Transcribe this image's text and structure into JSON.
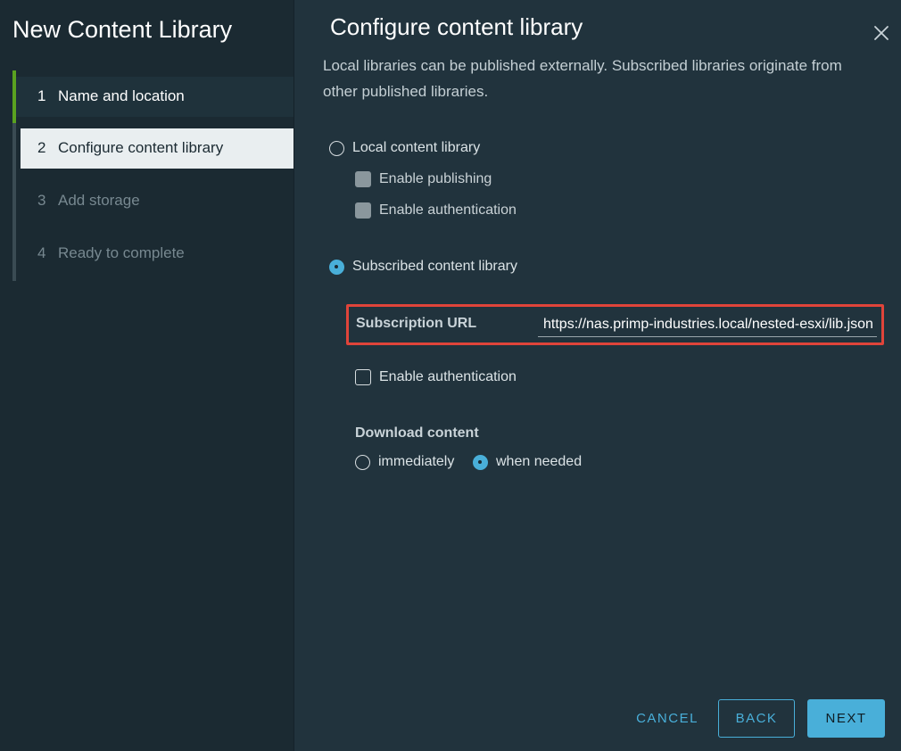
{
  "wizard": {
    "title": "New Content Library",
    "steps": [
      {
        "num": "1",
        "label": "Name and location"
      },
      {
        "num": "2",
        "label": "Configure content library"
      },
      {
        "num": "3",
        "label": "Add storage"
      },
      {
        "num": "4",
        "label": "Ready to complete"
      }
    ]
  },
  "main": {
    "title": "Configure content library",
    "description": "Local libraries can be published externally. Subscribed libraries originate from other published libraries.",
    "local_library": {
      "label": "Local content library",
      "selected": false,
      "enable_publishing": "Enable publishing",
      "enable_authentication": "Enable authentication"
    },
    "subscribed_library": {
      "label": "Subscribed content library",
      "selected": true,
      "subscription_url_label": "Subscription URL",
      "subscription_url_value": "https://nas.primp-industries.local/nested-esxi/lib.json",
      "enable_authentication": "Enable authentication",
      "download_content_label": "Download content",
      "download_options": [
        "immediately",
        "when needed"
      ],
      "download_selected": "when needed"
    }
  },
  "footer": {
    "cancel": "CANCEL",
    "back": "BACK",
    "next": "NEXT"
  },
  "colors": {
    "accent": "#49afd9",
    "done_step": "#5aa220",
    "highlight_box": "#e0443a"
  },
  "icons": {
    "close": "close-icon"
  }
}
